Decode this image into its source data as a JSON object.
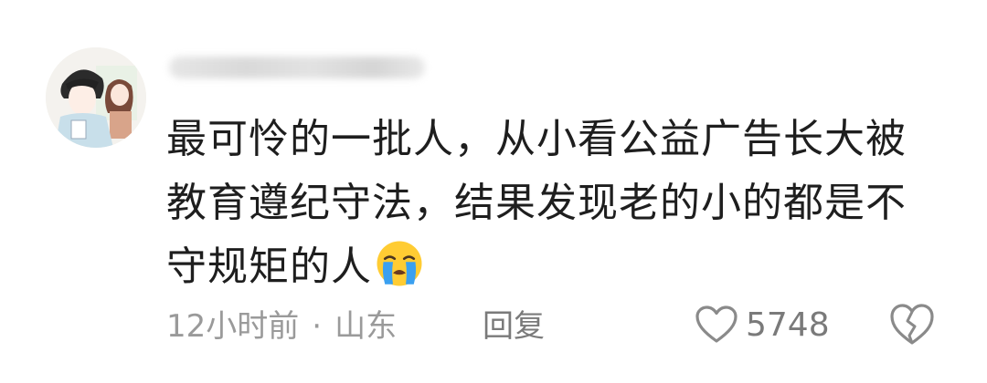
{
  "comment": {
    "text_lines": [
      "最可怜的一批人，从小看公益广告长大被",
      "教育遵纪守法，结果发现老的小的都是不",
      "守规矩的人"
    ],
    "emoji": "loudly-crying-face-icon",
    "time": "12小时前",
    "separator": "·",
    "location": "山东",
    "reply_label": "回复",
    "like_count": "5748"
  },
  "colors": {
    "text": "#1e1e1e",
    "meta": "#9a9a9a",
    "action": "#7a7a7a",
    "emoji_face": "#ffcc33",
    "emoji_tears": "#3aa0f0"
  }
}
